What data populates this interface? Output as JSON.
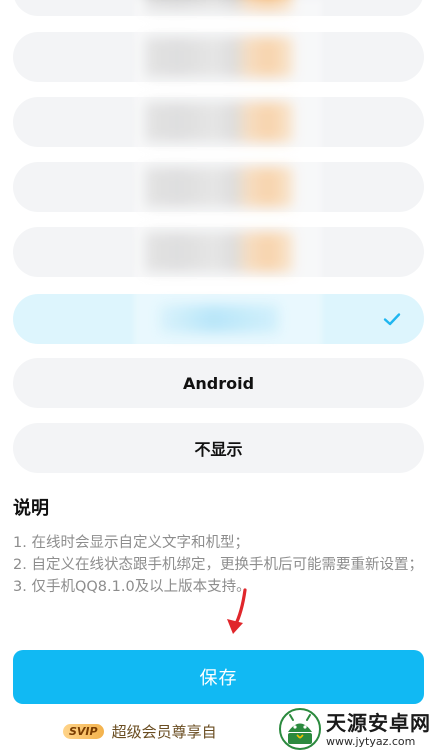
{
  "options": [
    {
      "label": "",
      "selected": false,
      "blurred": true
    },
    {
      "label": "",
      "selected": false,
      "blurred": true
    },
    {
      "label": "",
      "selected": false,
      "blurred": true
    },
    {
      "label": "",
      "selected": false,
      "blurred": true
    },
    {
      "label": "",
      "selected": false,
      "blurred": true
    },
    {
      "label": "",
      "selected": true,
      "blurred": true
    },
    {
      "label": "Android",
      "selected": false,
      "blurred": false
    },
    {
      "label": "不显示",
      "selected": false,
      "blurred": false
    }
  ],
  "description": {
    "title": "说明",
    "items": [
      "1. 在线时会显示自定义文字和机型；",
      "2. 自定义在线状态跟手机绑定，更换手机后可能需要重新设置；",
      "3. 仅手机QQ8.1.0及以上版本支持。"
    ]
  },
  "save_button": {
    "label": "保存"
  },
  "footer": {
    "badge": "SVIP",
    "text": "超级会员尊享自"
  },
  "watermark": {
    "name": "天源安卓网",
    "url": "www.jytyaz.com"
  },
  "colors": {
    "accent": "#11b9f3",
    "selected_bg": "#ddf5fd",
    "check": "#1fb6f0",
    "arrow": "#e0262b"
  }
}
